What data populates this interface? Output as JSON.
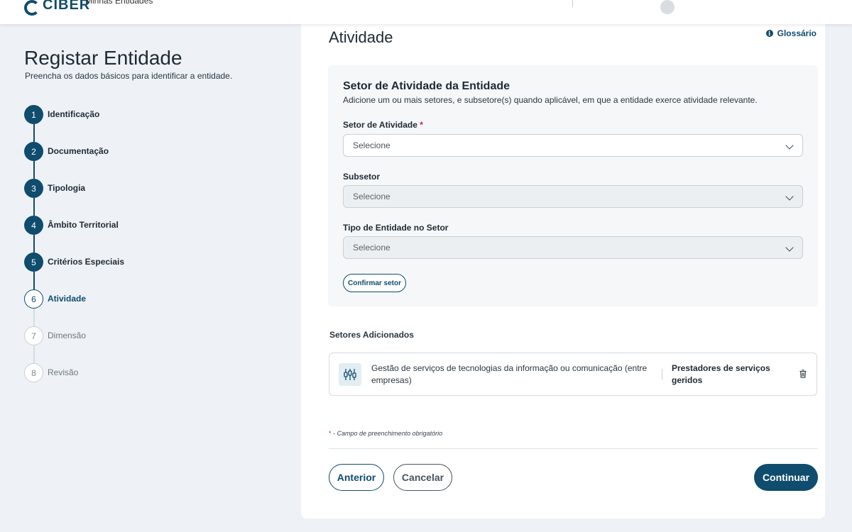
{
  "header": {
    "logo_text": "CIBER",
    "nav_text": "Minhas Entidades"
  },
  "left": {
    "title": "Registar Entidade",
    "subtitle": "Preencha os dados básicos para identificar a entidade.",
    "steps": [
      {
        "number": "1",
        "label": "Identificação",
        "state": "done"
      },
      {
        "number": "2",
        "label": "Documentação",
        "state": "done"
      },
      {
        "number": "3",
        "label": "Tipologia",
        "state": "done"
      },
      {
        "number": "4",
        "label": "Âmbito Territorial",
        "state": "done"
      },
      {
        "number": "5",
        "label": "Critérios Especiais",
        "state": "done"
      },
      {
        "number": "6",
        "label": "Atividade",
        "state": "current"
      },
      {
        "number": "7",
        "label": "Dimensão",
        "state": "future"
      },
      {
        "number": "8",
        "label": "Revisão",
        "state": "future"
      }
    ]
  },
  "main": {
    "title": "Atividade",
    "glossary_label": "Glossário",
    "sector_box": {
      "title": "Setor de Atividade da Entidade",
      "description": "Adicione um ou mais setores, e subsetore(s) quando aplicável, em que a entidade exerce atividade relevante.",
      "fields": [
        {
          "label": "Setor de Atividade",
          "required_mark": "*",
          "value": "Selecione"
        },
        {
          "label": "Subsetor",
          "required_mark": "",
          "value": "Selecione"
        },
        {
          "label": "Tipo de Entidade no Setor",
          "required_mark": "",
          "value": "Selecione"
        }
      ],
      "confirm_label": "Confirmar setor"
    },
    "added_title": "Setores Adicionados",
    "added_items": [
      {
        "sector": "Gestão de serviços de tecnologias da informação ou comunicação (entre empresas)",
        "entity_type": "Prestadores de serviços geridos",
        "icon": "network-nodes-icon"
      }
    ],
    "required_note_star": "*",
    "required_note": " - Campo de preenchimento obrigatório",
    "buttons": {
      "previous": "Anterior",
      "cancel": "Cancelar",
      "continue": "Continuar"
    }
  },
  "colors": {
    "primary": "#0f4c6e",
    "required": "#c0272d",
    "background": "#eef2f6"
  }
}
